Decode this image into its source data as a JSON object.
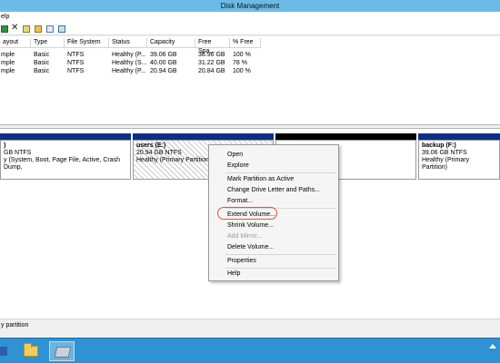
{
  "window": {
    "title": "Disk Management"
  },
  "menu": {
    "help_label": "elp"
  },
  "toolbar": {
    "buttons": [
      "back-icon",
      "delete-icon",
      "properties-icon",
      "open-icon",
      "search-icon",
      "grid-icon"
    ],
    "delete_glyph": "✕"
  },
  "volumes": {
    "headers": [
      "ayout",
      "Type",
      "File System",
      "Status",
      "Capacity",
      "Free Spa...",
      "% Free"
    ],
    "rows": [
      [
        "mple",
        "Basic",
        "NTFS",
        "Healthy (P...",
        "39.06 GB",
        "38.96 GB",
        "100 %"
      ],
      [
        "mple",
        "Basic",
        "NTFS",
        "Healthy (S...",
        "40.00 GB",
        "31.22 GB",
        "78 %"
      ],
      [
        "mple",
        "Basic",
        "NTFS",
        "Healthy (P...",
        "20.94 GB",
        "20.84 GB",
        "100 %"
      ]
    ]
  },
  "disk": {
    "partitions": [
      {
        "name": ")",
        "size": "GB NTFS",
        "status": "y (System, Boot, Page File, Active, Crash Dump,"
      },
      {
        "name": "users  (E:)",
        "size": "20.94 GB NTFS",
        "status": "Healthy (Primary Partition)"
      },
      {
        "name": "",
        "size": "",
        "status": ""
      },
      {
        "name": "backup  (F:)",
        "size": "39.06 GB NTFS",
        "status": "Healthy (Primary Partition)"
      }
    ],
    "legend_label": "y partition"
  },
  "context_menu": {
    "items": [
      {
        "label": "Open",
        "enabled": true
      },
      {
        "label": "Explore",
        "enabled": true
      },
      {
        "label": "Mark Partition as Active",
        "enabled": true
      },
      {
        "label": "Change Drive Letter and Paths...",
        "enabled": true
      },
      {
        "label": "Format...",
        "enabled": true
      },
      {
        "label": "Extend Volume...",
        "enabled": true,
        "highlighted": true
      },
      {
        "label": "Shrink Volume...",
        "enabled": true
      },
      {
        "label": "Add Mirror...",
        "enabled": false
      },
      {
        "label": "Delete Volume...",
        "enabled": true
      },
      {
        "label": "Properties",
        "enabled": true
      },
      {
        "label": "Help",
        "enabled": true
      }
    ]
  },
  "taskbar": {
    "apps": [
      "powershell-icon",
      "file-explorer-icon",
      "disk-management-icon"
    ],
    "tray_icon": "tray-expand-icon"
  },
  "colors": {
    "titlebar": "#6cbbe6",
    "taskbar": "#2f92d4",
    "partition_bar_blue": "#0a2f8a",
    "partition_bar_black": "#000000",
    "highlight_ring": "#e05a27"
  }
}
